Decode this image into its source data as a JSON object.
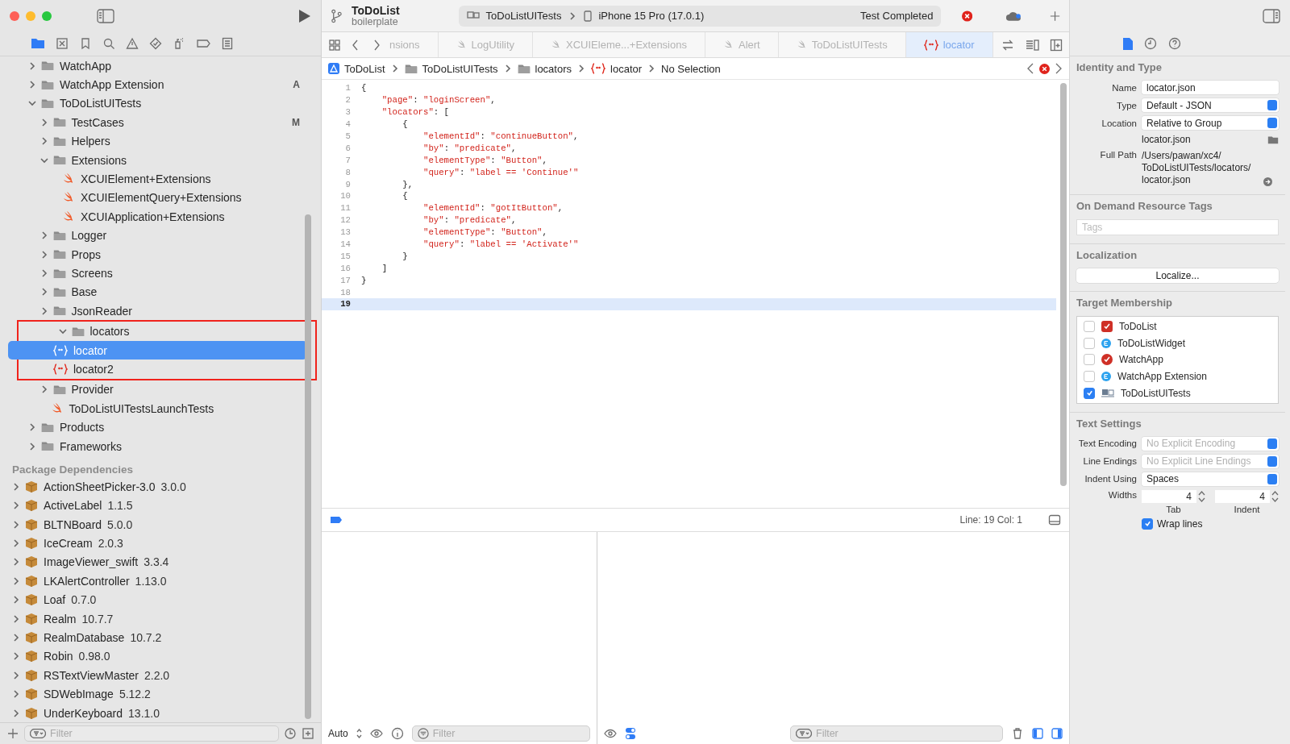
{
  "toolbar": {
    "project": "ToDoList",
    "branch": "boilerplate",
    "scheme": "ToDoListUITests",
    "device": "iPhone 15 Pro (17.0.1)",
    "status": "Test Completed"
  },
  "navigator": {
    "tree": [
      {
        "label": "WatchApp",
        "kind": "folder",
        "expanded": false
      },
      {
        "label": "WatchApp Extension",
        "kind": "folder",
        "expanded": false,
        "badge": "A"
      },
      {
        "label": "ToDoListUITests",
        "kind": "folder",
        "expanded": true,
        "children": [
          {
            "label": "TestCases",
            "kind": "folder",
            "expanded": false,
            "badge": "M"
          },
          {
            "label": "Helpers",
            "kind": "folder",
            "expanded": false
          },
          {
            "label": "Extensions",
            "kind": "folder",
            "expanded": true,
            "children": [
              {
                "label": "XCUIElement+Extensions",
                "kind": "swift"
              },
              {
                "label": "XCUIElementQuery+Extensions",
                "kind": "swift"
              },
              {
                "label": "XCUIApplication+Extensions",
                "kind": "swift"
              }
            ]
          },
          {
            "label": "Logger",
            "kind": "folder",
            "expanded": false
          },
          {
            "label": "Props",
            "kind": "folder",
            "expanded": false
          },
          {
            "label": "Screens",
            "kind": "folder",
            "expanded": false
          },
          {
            "label": "Base",
            "kind": "folder",
            "expanded": false
          },
          {
            "label": "JsonReader",
            "kind": "folder",
            "expanded": false
          },
          {
            "label": "locators",
            "kind": "folder",
            "expanded": true,
            "highlighted": true,
            "children": [
              {
                "label": "locator",
                "kind": "json",
                "selected": true
              },
              {
                "label": "locator2",
                "kind": "json",
                "selected": false
              }
            ]
          },
          {
            "label": "Provider",
            "kind": "folder",
            "expanded": false
          },
          {
            "label": "ToDoListUITestsLaunchTests",
            "kind": "swift"
          }
        ]
      },
      {
        "label": "Products",
        "kind": "folder",
        "expanded": false
      },
      {
        "label": "Frameworks",
        "kind": "folder",
        "expanded": false
      }
    ],
    "packages_title": "Package Dependencies",
    "packages": [
      {
        "name": "ActionSheetPicker-3.0",
        "version": "3.0.0"
      },
      {
        "name": "ActiveLabel",
        "version": "1.1.5"
      },
      {
        "name": "BLTNBoard",
        "version": "5.0.0"
      },
      {
        "name": "IceCream",
        "version": "2.0.3"
      },
      {
        "name": "ImageViewer_swift",
        "version": "3.3.4"
      },
      {
        "name": "LKAlertController",
        "version": "1.13.0"
      },
      {
        "name": "Loaf",
        "version": "0.7.0"
      },
      {
        "name": "Realm",
        "version": "10.7.7"
      },
      {
        "name": "RealmDatabase",
        "version": "10.7.2"
      },
      {
        "name": "Robin",
        "version": "0.98.0"
      },
      {
        "name": "RSTextViewMaster",
        "version": "2.2.0"
      },
      {
        "name": "SDWebImage",
        "version": "5.12.2"
      },
      {
        "name": "UnderKeyboard",
        "version": "13.1.0"
      }
    ],
    "filter": {
      "placeholder": "Filter"
    }
  },
  "editor": {
    "tabs": [
      {
        "label": "nsions",
        "selected": false
      },
      {
        "label": "LogUtility",
        "kind": "swift",
        "selected": false
      },
      {
        "label": "XCUIEleme...+Extensions",
        "kind": "swift",
        "selected": false
      },
      {
        "label": "Alert",
        "kind": "swift",
        "selected": false
      },
      {
        "label": "ToDoListUITests",
        "kind": "swift",
        "selected": false
      },
      {
        "label": "locator",
        "kind": "json",
        "selected": true
      }
    ],
    "jump_bar": [
      {
        "label": "ToDoList",
        "kind": "project"
      },
      {
        "label": "ToDoListUITests",
        "kind": "folder"
      },
      {
        "label": "locators",
        "kind": "folder"
      },
      {
        "label": "locator",
        "kind": "json"
      },
      {
        "label": "No Selection",
        "kind": "text"
      }
    ],
    "lines": [
      {
        "number": "1",
        "text": "{",
        "current": false
      },
      {
        "number": "2",
        "text": "    \"page\": \"loginScreen\",",
        "current": false
      },
      {
        "number": "3",
        "text": "    \"locators\": [",
        "current": false
      },
      {
        "number": "4",
        "text": "        {",
        "current": false
      },
      {
        "number": "5",
        "text": "            \"elementId\": \"continueButton\",",
        "current": false
      },
      {
        "number": "6",
        "text": "            \"by\": \"predicate\",",
        "current": false
      },
      {
        "number": "7",
        "text": "            \"elementType\": \"Button\",",
        "current": false
      },
      {
        "number": "8",
        "text": "            \"query\": \"label == 'Continue'\"",
        "current": false
      },
      {
        "number": "9",
        "text": "        },",
        "current": false
      },
      {
        "number": "10",
        "text": "        {",
        "current": false
      },
      {
        "number": "11",
        "text": "            \"elementId\": \"gotItButton\",",
        "current": false
      },
      {
        "number": "12",
        "text": "            \"by\": \"predicate\",",
        "current": false
      },
      {
        "number": "13",
        "text": "            \"elementType\": \"Button\",",
        "current": false
      },
      {
        "number": "14",
        "text": "            \"query\": \"label == 'Activate'\"",
        "current": false
      },
      {
        "number": "15",
        "text": "        }",
        "current": false
      },
      {
        "number": "16",
        "text": "    ]",
        "current": false
      },
      {
        "number": "17",
        "text": "}",
        "current": false
      },
      {
        "number": "18",
        "current": false
      },
      {
        "number": "19",
        "current": true
      }
    ],
    "cursor": "Line: 19  Col: 1"
  },
  "debug": {
    "mode": "Auto",
    "variables_filter": {
      "placeholder": "Filter"
    },
    "console_filter": {
      "placeholder": "Filter"
    }
  },
  "inspector": {
    "identity": {
      "title": "Identity and Type",
      "fields": [
        {
          "label": "Name",
          "value": "locator.json",
          "kind": "text",
          "disabled": false
        },
        {
          "label": "Type",
          "value": "Default - JSON",
          "kind": "popup",
          "disabled": false
        },
        {
          "label": "Location",
          "value": "Relative to Group",
          "kind": "popup",
          "disabled": false
        }
      ],
      "file": "locator.json",
      "full_path_label": "Full Path",
      "full_path": [
        "/Users/pawan/xc4/",
        "ToDoListUITests/locators/",
        "locator.json"
      ]
    },
    "tags": {
      "title": "On Demand Resource Tags",
      "placeholder": "Tags"
    },
    "localization": {
      "title": "Localization",
      "button": "Localize..."
    },
    "targets": {
      "title": "Target Membership",
      "items": [
        {
          "name": "ToDoList",
          "checked": false,
          "kind": "app"
        },
        {
          "name": "ToDoListWidget",
          "checked": false,
          "kind": "extension"
        },
        {
          "name": "WatchApp",
          "checked": false,
          "kind": "watch"
        },
        {
          "name": "WatchApp Extension",
          "checked": false,
          "kind": "extension"
        },
        {
          "name": "ToDoListUITests",
          "checked": true,
          "kind": "tests"
        }
      ]
    },
    "text_settings": {
      "title": "Text Settings",
      "fields": [
        {
          "label": "Text Encoding",
          "value": "No Explicit Encoding",
          "kind": "popup",
          "disabled": true
        },
        {
          "label": "Line Endings",
          "value": "No Explicit Line Endings",
          "kind": "popup",
          "disabled": true
        },
        {
          "label": "Indent Using",
          "value": "Spaces",
          "kind": "popup",
          "disabled": false
        }
      ],
      "widths_label": "Widths",
      "widths": [
        {
          "value": "4",
          "caption": "Tab"
        },
        {
          "value": "4",
          "caption": "Indent"
        }
      ],
      "wrap": {
        "label": "Wrap lines",
        "checked": true
      }
    }
  }
}
